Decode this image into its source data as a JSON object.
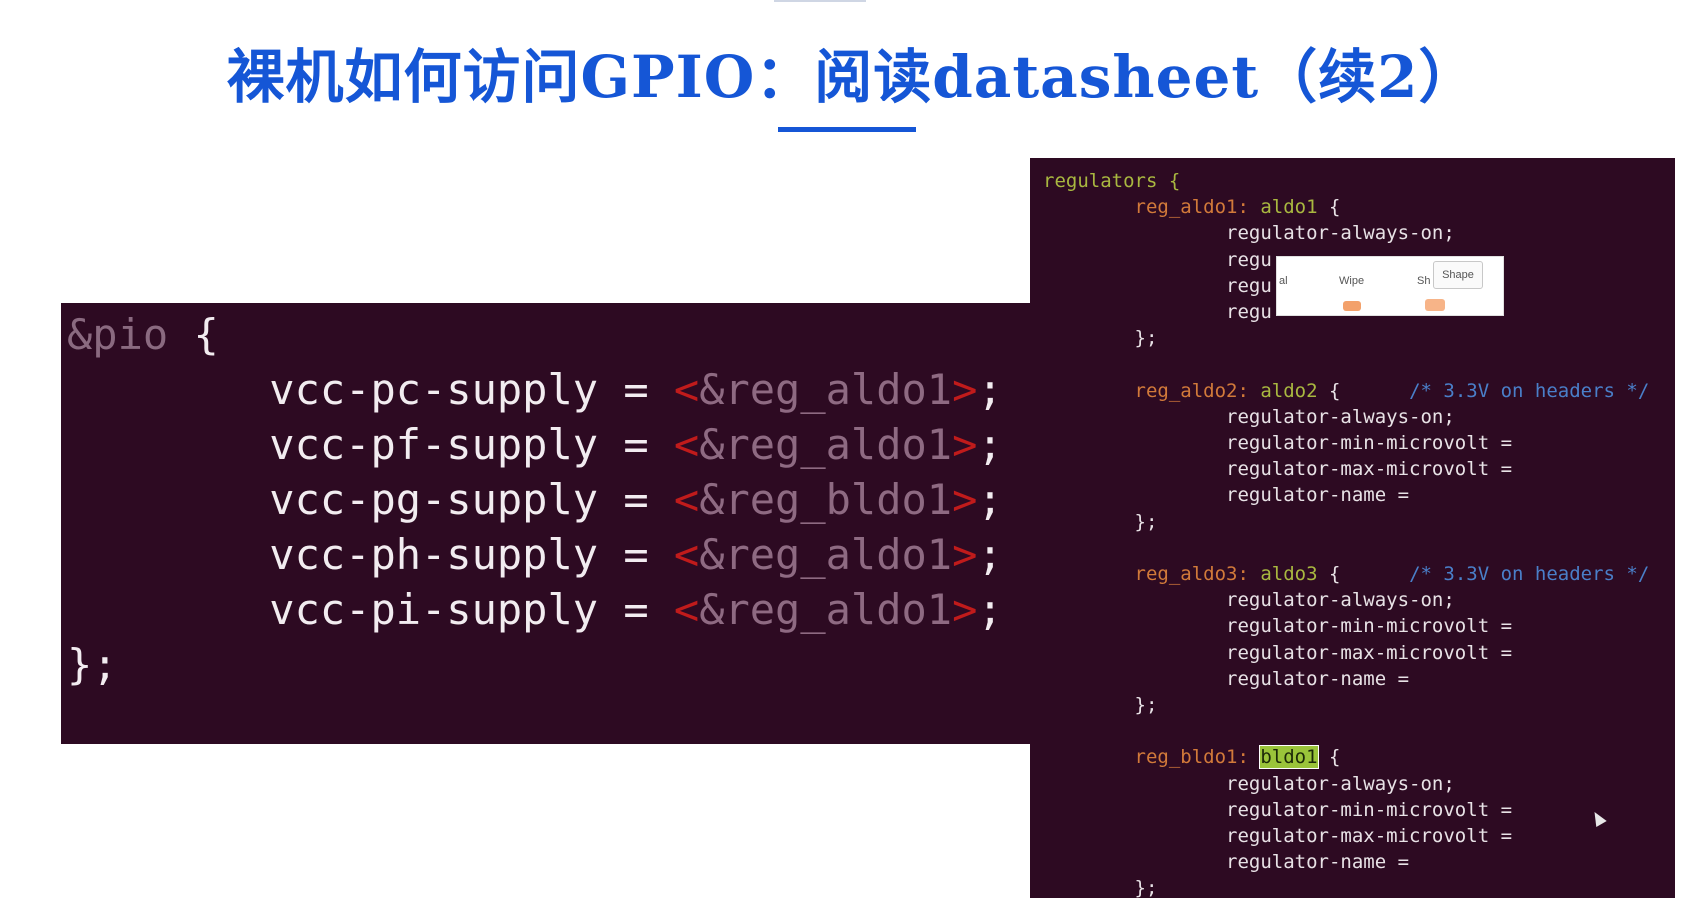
{
  "slide": {
    "title": "裸机如何访问GPIO：阅读datasheet（续2）"
  },
  "left_panel": {
    "open_line": {
      "node": "&pio",
      "brace": " {"
    },
    "lines": [
      {
        "prop": "vcc-pc-supply",
        "ref": "&reg_aldo1"
      },
      {
        "prop": "vcc-pf-supply",
        "ref": "&reg_aldo1"
      },
      {
        "prop": "vcc-pg-supply",
        "ref": "&reg_bldo1"
      },
      {
        "prop": "vcc-ph-supply",
        "ref": "&reg_aldo1"
      },
      {
        "prop": "vcc-pi-supply",
        "ref": "&reg_aldo1"
      }
    ],
    "close_line": "};"
  },
  "right_panel": {
    "header": "regulators {",
    "blocks": [
      {
        "label": "reg_aldo1:",
        "node": "aldo1",
        "open": " {",
        "comment": "",
        "props": [
          "regulator-always-on;",
          "regu",
          "regu",
          "regu"
        ],
        "close": "};"
      },
      {
        "label": "reg_aldo2:",
        "node": "aldo2",
        "open": " {",
        "comment": "/* 3.3V on headers */",
        "props": [
          "regulator-always-on;",
          "regulator-min-microvolt =",
          "regulator-max-microvolt =",
          "regulator-name ="
        ],
        "close": "};"
      },
      {
        "label": "reg_aldo3:",
        "node": "aldo3",
        "open": " {",
        "comment": "/* 3.3V on headers */",
        "props": [
          "regulator-always-on;",
          "regulator-min-microvolt =",
          "regulator-max-microvolt =",
          "regulator-name ="
        ],
        "close": "};"
      },
      {
        "label": "reg_bldo1:",
        "node": "bldo1",
        "open": " {",
        "comment": "",
        "props": [
          "regulator-always-on;",
          "regulator-min-microvolt =",
          "regulator-max-microvolt =",
          "regulator-name ="
        ],
        "close": "};"
      }
    ]
  },
  "popup": {
    "items": [
      "al",
      "Wipe",
      "Sh"
    ],
    "button_label": "Shape"
  },
  "colors": {
    "title": "#1556d6",
    "terminal_bg": "#2d0a22",
    "node_green": "#a9b840",
    "label_orange": "#d27a3a",
    "comment_blue": "#4a7fc9",
    "value_red": "#c2191c"
  }
}
